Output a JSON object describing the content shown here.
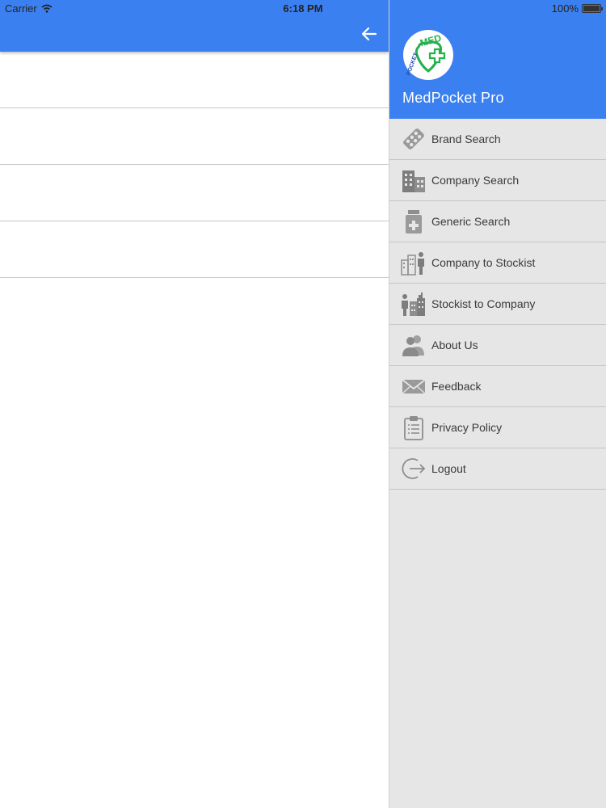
{
  "status_bar": {
    "carrier": "Carrier",
    "time": "6:18 PM",
    "battery": "100%",
    "battery_level": 1.0
  },
  "drawer": {
    "app_name": "MedPocket Pro",
    "logo_text": {
      "top": "MED",
      "side": "POCKET"
    },
    "items": [
      {
        "label": "Brand Search",
        "icon": "pill-strip-icon"
      },
      {
        "label": "Company Search",
        "icon": "building-icon"
      },
      {
        "label": "Generic Search",
        "icon": "medicine-bottle-icon"
      },
      {
        "label": "Company to Stockist",
        "icon": "buildings-person-icon"
      },
      {
        "label": "Stockist to Company",
        "icon": "person-buildings-icon"
      },
      {
        "label": "About Us",
        "icon": "people-icon"
      },
      {
        "label": "Feedback",
        "icon": "envelope-icon"
      },
      {
        "label": "Privacy Policy",
        "icon": "clipboard-icon"
      },
      {
        "label": "Logout",
        "icon": "logout-icon"
      }
    ]
  },
  "colors": {
    "primary": "#3b80f0",
    "drawer_bg": "#e6e6e6",
    "icon_gray": "#8e8e8e",
    "logo_green": "#22b14c"
  }
}
